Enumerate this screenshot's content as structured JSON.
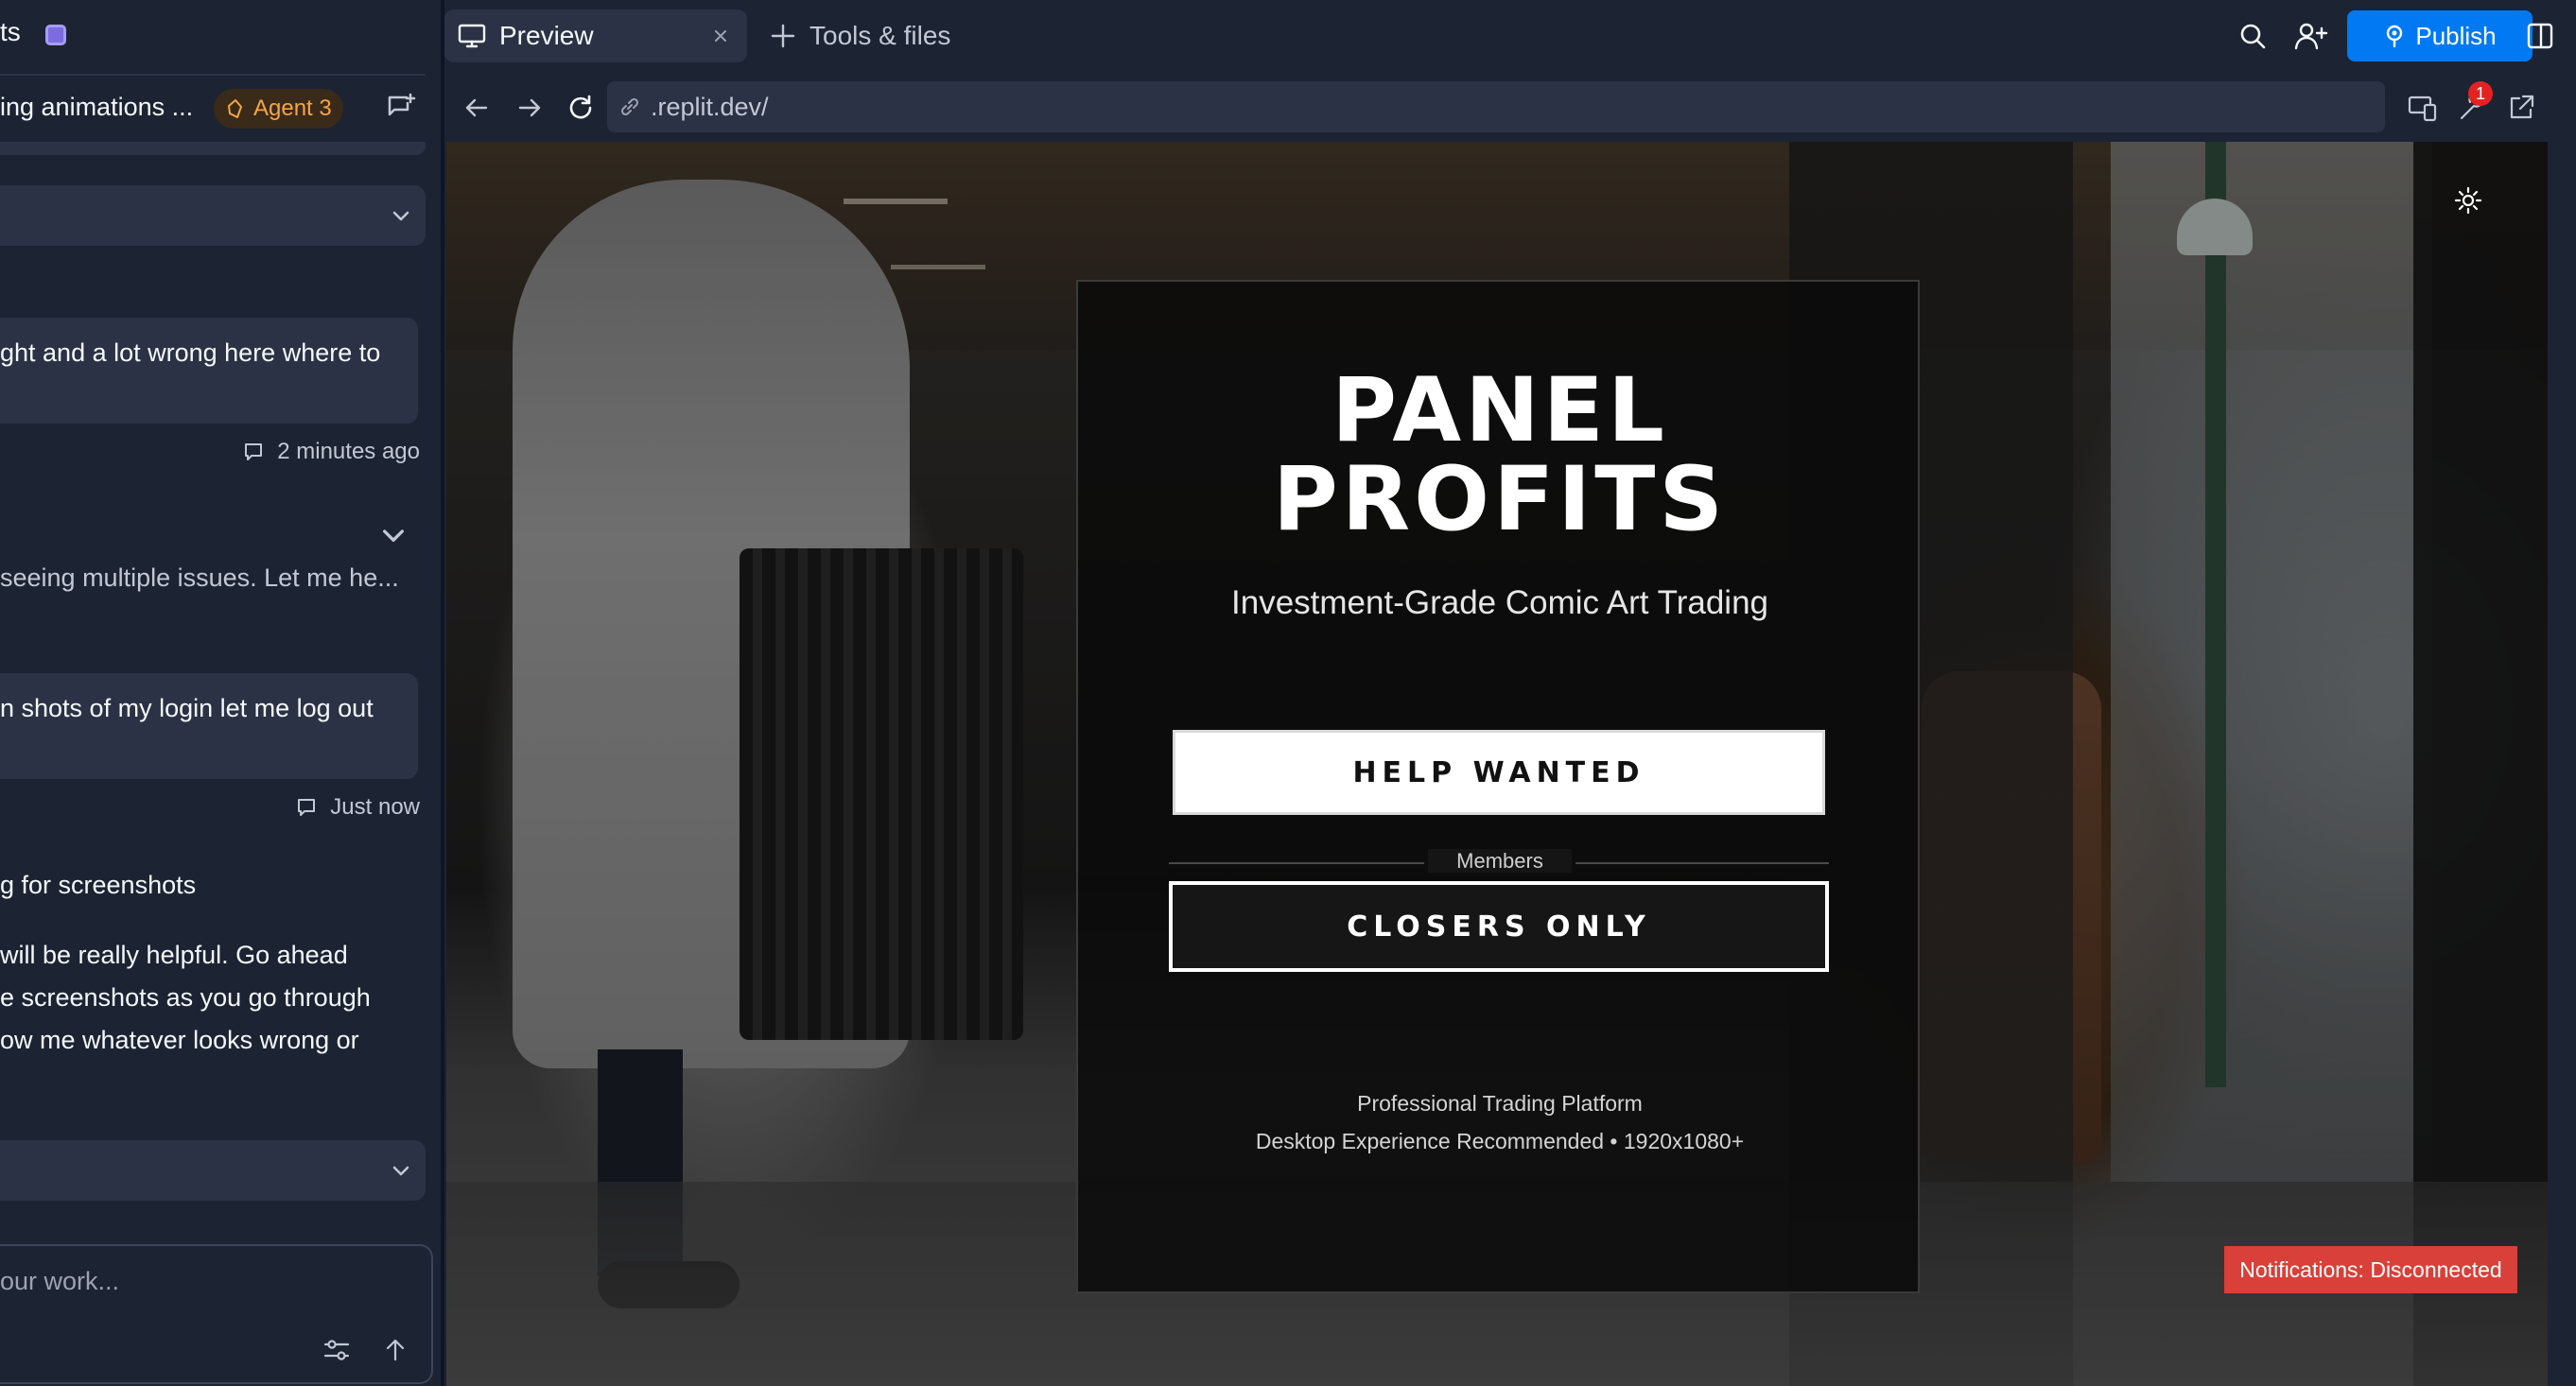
{
  "workspace": {
    "title_fragment": "ts",
    "chat_title": "ing animations ...",
    "agent_badge": "Agent 3"
  },
  "chat": {
    "messages": [
      {
        "role": "user",
        "text": "ght and a lot wrong here where to",
        "meta": "2 minutes ago"
      },
      {
        "role": "agent",
        "text": "seeing multiple issues. Let me he..."
      },
      {
        "role": "user",
        "text": "n shots of my login let me log out",
        "meta": "Just now"
      },
      {
        "role": "agent_heading",
        "text": "g for screenshots"
      },
      {
        "role": "agent",
        "lines": [
          " will be really helpful. Go ahead",
          "e screenshots as you go through",
          "ow me whatever looks wrong or"
        ]
      }
    ],
    "composer_placeholder": "our work..."
  },
  "tabs": {
    "preview_label": "Preview",
    "add_label": "Tools & files"
  },
  "toolbar": {
    "publish_label": "Publish"
  },
  "preview": {
    "url": ".replit.dev/",
    "devtools_badge": "1"
  },
  "app": {
    "title_line1": "PANEL",
    "title_line2": "PROFITS",
    "subtitle": "Investment-Grade Comic Art Trading",
    "primary_button": "HELP WANTED",
    "separator_label": "Members",
    "secondary_button": "CLOSERS ONLY",
    "footer_line1": "Professional Trading Platform",
    "footer_line2": "Desktop Experience Recommended • 1920x1080+",
    "notification": "Notifications: Disconnected"
  },
  "colors": {
    "ide_bg": "#1c2333",
    "ide_surface": "#2b3245",
    "publish_blue": "#0079f2",
    "agent_orange": "#f5a546",
    "toast_red": "#d9403a"
  }
}
